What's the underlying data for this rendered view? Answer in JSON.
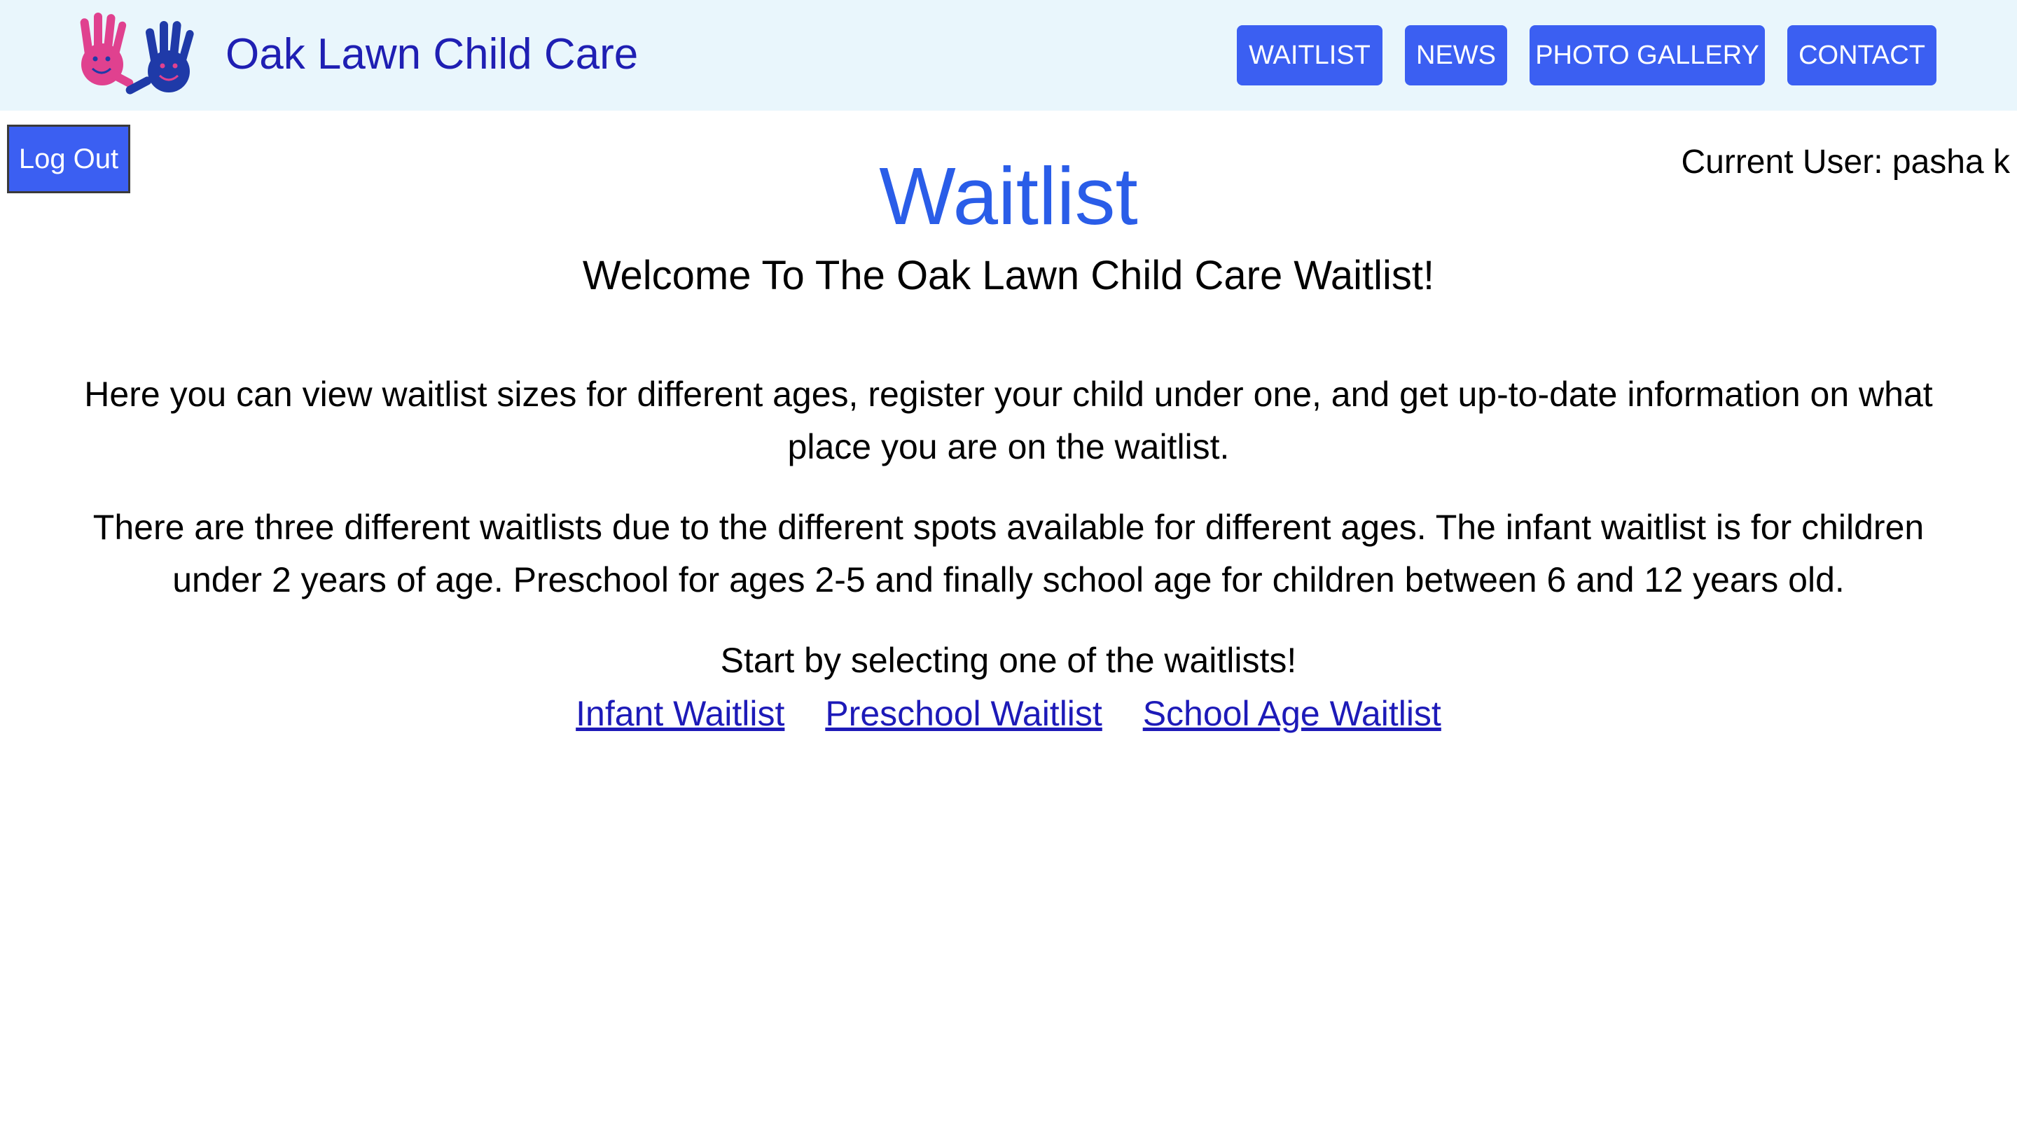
{
  "header": {
    "brand_name": "Oak Lawn Child Care",
    "logo_icon": "two-hands-logo-icon",
    "colors": {
      "background": "#e9f6fc",
      "brand_text": "#1f1fb3",
      "nav_button": "#3b5ff2",
      "pink_hand": "#e0418f",
      "blue_hand": "#1f3aa8"
    },
    "nav": [
      {
        "label": "WAITLIST"
      },
      {
        "label": "NEWS"
      },
      {
        "label": "PHOTO GALLERY"
      },
      {
        "label": "CONTACT"
      }
    ]
  },
  "session": {
    "logout_label": "Log Out",
    "current_user_text": "Current User: pasha k"
  },
  "main": {
    "title": "Waitlist",
    "title_color": "#2a5de8",
    "welcome": "Welcome To The Oak Lawn Child Care Waitlist!",
    "paragraphs": [
      "Here you can view waitlist sizes for different ages, register your child under one, and get up-to-date information on what place you are on the waitlist.",
      "There are three different waitlists due to the different spots available for different ages. The infant waitlist is for children under 2 years of age. Preschool for ages 2-5 and finally school age for children between 6 and 12 years old."
    ],
    "start_text": "Start by selecting one of the waitlists!",
    "links": [
      {
        "label": "Infant Waitlist"
      },
      {
        "label": "Preschool Waitlist"
      },
      {
        "label": "School Age Waitlist"
      }
    ],
    "link_color": "#1d1ab8"
  }
}
